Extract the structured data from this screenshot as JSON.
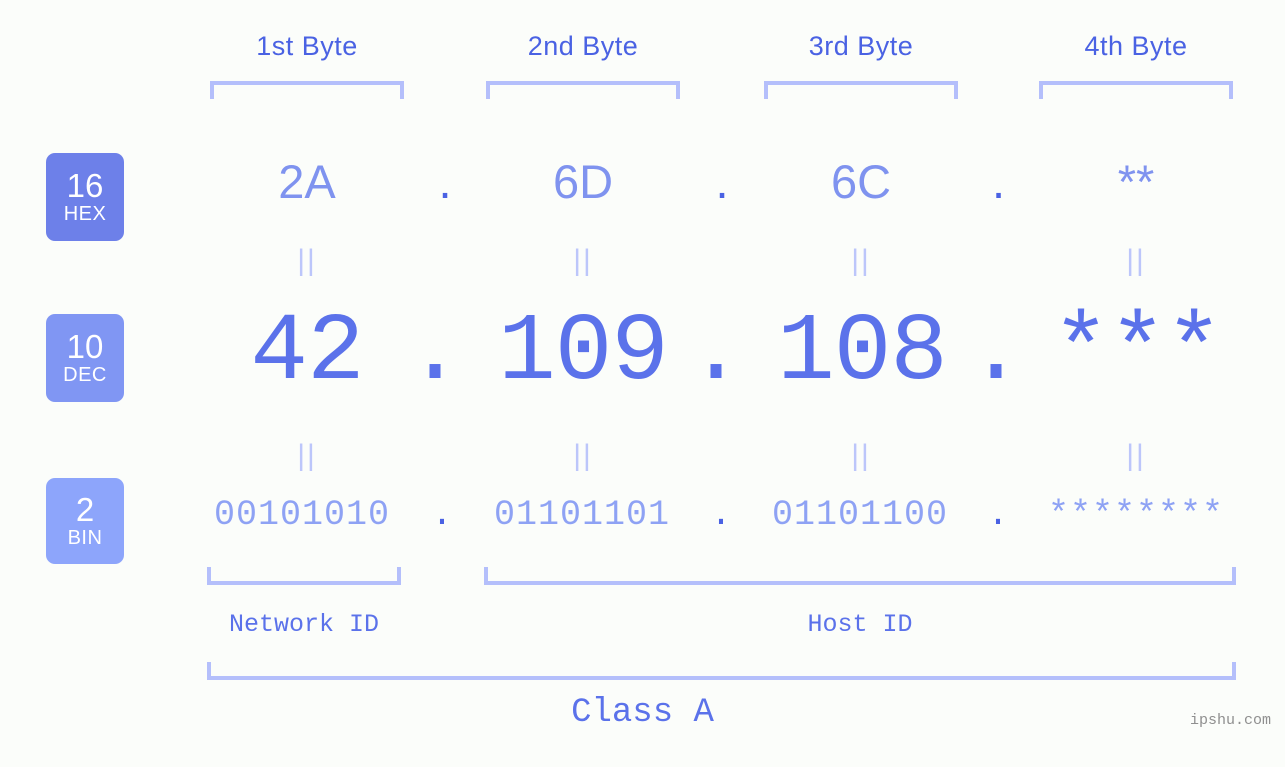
{
  "watermark": "ipshu.com",
  "columns": [
    {
      "label": "1st Byte"
    },
    {
      "label": "2nd Byte"
    },
    {
      "label": "3rd Byte"
    },
    {
      "label": "4th Byte"
    }
  ],
  "bases": [
    {
      "number": "16",
      "abbr": "HEX"
    },
    {
      "number": "10",
      "abbr": "DEC"
    },
    {
      "number": "2",
      "abbr": "BIN"
    }
  ],
  "rows": {
    "hex": {
      "values": [
        "2A",
        "6D",
        "6C",
        "**"
      ],
      "separator": "."
    },
    "dec": {
      "values": [
        "42",
        "109",
        "108",
        "***"
      ],
      "separator": "."
    },
    "bin": {
      "values": [
        "00101010",
        "01101101",
        "01101100",
        "********"
      ],
      "separator": "."
    }
  },
  "equals_marks": {
    "hex_to_dec": [
      "||",
      "||",
      "||",
      "||"
    ],
    "dec_to_bin": [
      "||",
      "||",
      "||",
      "||"
    ]
  },
  "id_sections": [
    {
      "label": "Network ID"
    },
    {
      "label": "Host ID"
    }
  ],
  "class": {
    "label": "Class A"
  },
  "colors": {
    "background": "#fbfdfa",
    "accent": "#5b72ea",
    "header_text": "#4a62e3",
    "bracket": "#b4bffb",
    "badge_hex": "#6d80e9",
    "badge_dec": "#8096f3",
    "badge_bin": "#8da5fb",
    "hex_value": "#7f93ef",
    "bin_value": "#8ea2f4",
    "equals_mark": "#bcc6fa",
    "watermark": "#8f8f8f"
  }
}
